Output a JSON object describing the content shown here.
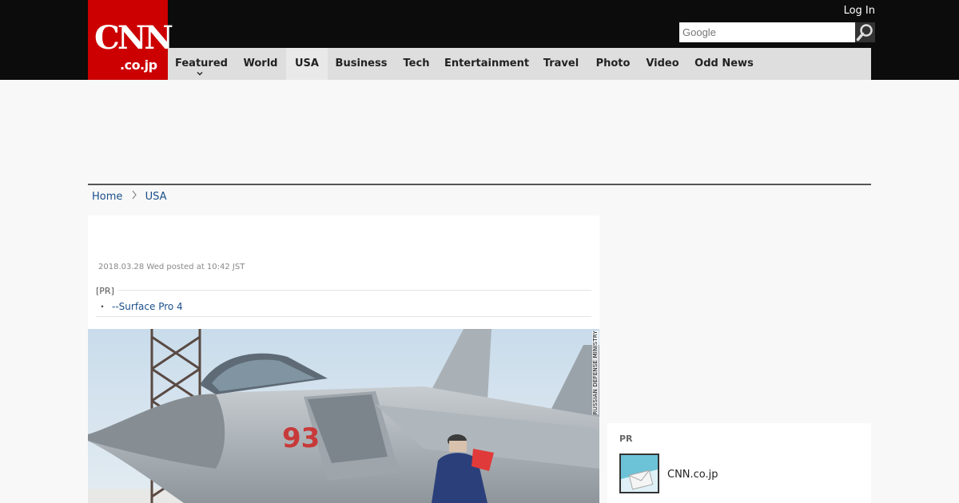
{
  "header": {
    "logo_text": "CNN",
    "logo_subtext": ".co.jp",
    "login_label": "Log In",
    "search": {
      "placeholder": "Google"
    }
  },
  "nav": {
    "items": [
      {
        "label": "Featured",
        "has_dropdown": true
      },
      {
        "label": "World"
      },
      {
        "label": "USA",
        "active": true
      },
      {
        "label": "Business"
      },
      {
        "label": "Tech"
      },
      {
        "label": "Entertainment"
      },
      {
        "label": "Travel"
      },
      {
        "label": "Photo"
      },
      {
        "label": "Video"
      },
      {
        "label": "Odd News"
      }
    ]
  },
  "breadcrumb": {
    "home": "Home",
    "current": "USA"
  },
  "article": {
    "dateline": "2018.03.28 Wed posted at 10:42 JST",
    "pr": {
      "label": "[PR]",
      "bullet": "・",
      "link": "--Surface Pro 4"
    },
    "photo": {
      "credit": "RUSSIAN DEFENSE MINISTRY",
      "aircraft_number": "93"
    }
  },
  "sidebar": {
    "pr": {
      "title": "PR",
      "item_label": "CNN.co.jp"
    }
  },
  "colors": {
    "topbar": "#0c0c0c",
    "logo_bg": "#cc0000",
    "nav_bg": "#dedede",
    "nav_active": "#e9e9e9",
    "link": "#1a4e8a",
    "page_bg": "#f8f8f8"
  },
  "icons": {
    "search": "magnifier-icon",
    "breadcrumb_separator": "chevron-right-icon",
    "nav_dropdown": "chevron-down-icon",
    "pr_thumb": "mail-envelope-icon"
  }
}
